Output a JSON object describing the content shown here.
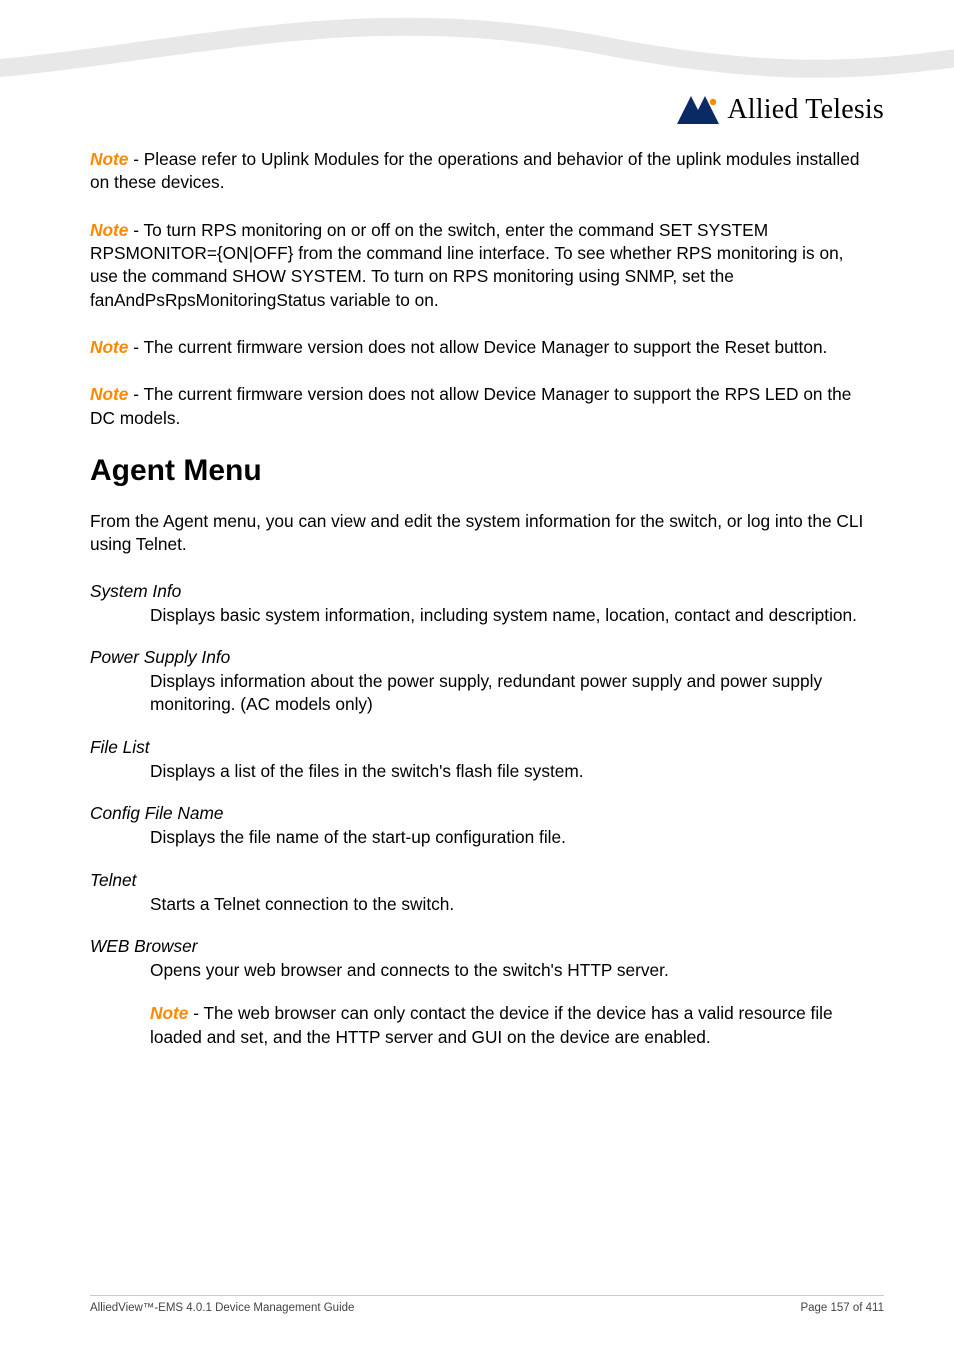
{
  "brand": {
    "name": "Allied Telesis"
  },
  "notes": {
    "label": "Note",
    "n1": " - Please refer to Uplink Modules for the operations and behavior of the uplink modules installed on these devices.",
    "n2": " - To turn RPS monitoring on or off on the switch, enter the command SET SYSTEM RPSMONITOR={ON|OFF} from the command line interface. To see whether RPS monitoring is on, use the command SHOW SYSTEM. To turn on RPS monitoring using SNMP, set the fanAndPsRpsMonitoringStatus variable to on.",
    "n3": " - The current firmware version does not allow Device Manager to support the Reset button.",
    "n4": " - The current firmware version does not allow Device Manager to support the RPS LED on the DC models.",
    "n5": " - The web browser can only contact the device if the device has a valid resource file loaded and set, and the HTTP server and GUI on the device are enabled."
  },
  "heading": "Agent Menu",
  "intro": "From the Agent menu, you can view and edit the system information for the switch, or log into the CLI using Telnet.",
  "defs": {
    "system_info": {
      "term": "System Info",
      "text": "Displays basic system information, including system name, location, contact and description."
    },
    "psu": {
      "term": "Power Supply Info",
      "text": "Displays information about the power supply, redundant power supply and power supply monitoring. (AC models only)"
    },
    "file_list": {
      "term": "File List",
      "text": "Displays a list of the files in the switch's flash file system."
    },
    "config": {
      "term": "Config File Name",
      "text": "Displays the file name of the start-up configuration file."
    },
    "telnet": {
      "term": "Telnet",
      "text": "Starts a Telnet connection to the switch."
    },
    "web": {
      "term": "WEB Browser",
      "text": "Opens your web browser and connects to the switch's HTTP server."
    }
  },
  "footer": {
    "left": "AlliedView™-EMS 4.0.1 Device Management Guide",
    "right": "Page 157 of 411"
  }
}
